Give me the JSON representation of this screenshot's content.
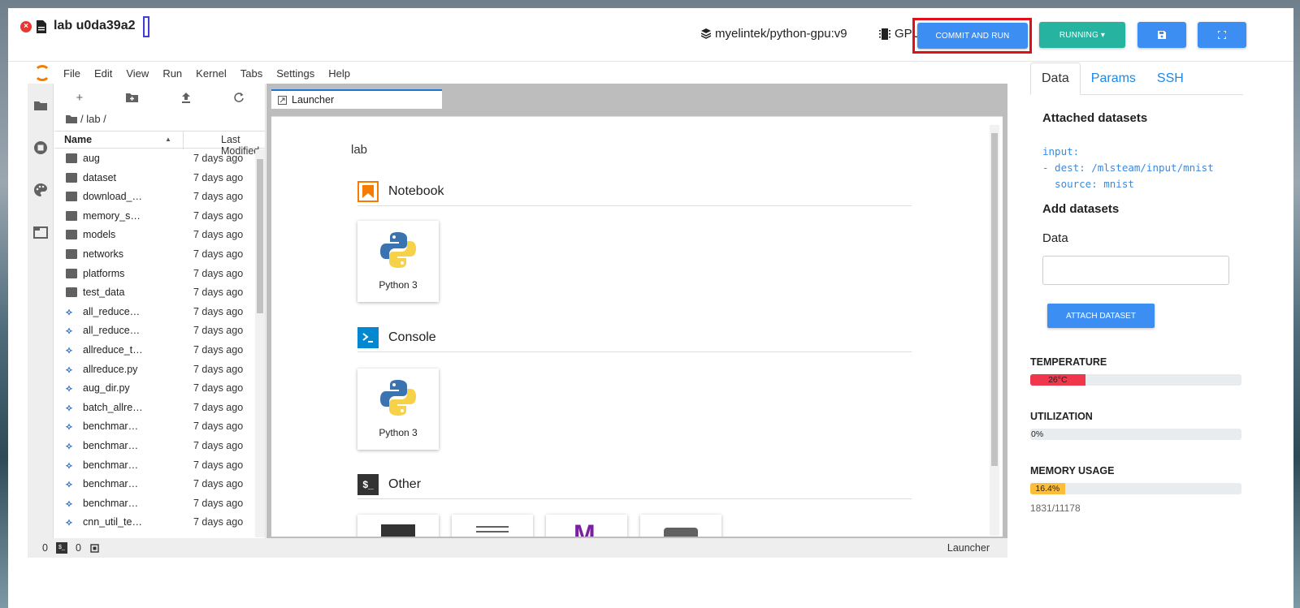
{
  "header": {
    "lab_name": "lab u0da39a2",
    "image": "myelintek/python-gpu:v9",
    "device": "GPU",
    "commit_label": "COMMIT AND RUN",
    "running_label": "RUNNING ▾",
    "save_icon": "save-icon",
    "fullscreen_icon": "fullscreen-icon"
  },
  "menubar": {
    "items": [
      "File",
      "Edit",
      "View",
      "Run",
      "Kernel",
      "Tabs",
      "Settings",
      "Help"
    ]
  },
  "file_browser": {
    "breadcrumb": "/ lab /",
    "col_name": "Name",
    "col_modified": "Last Modified",
    "rows": [
      {
        "name": "aug",
        "type": "folder",
        "modified": "7 days ago"
      },
      {
        "name": "dataset",
        "type": "folder",
        "modified": "7 days ago"
      },
      {
        "name": "download_…",
        "type": "folder",
        "modified": "7 days ago"
      },
      {
        "name": "memory_s…",
        "type": "folder",
        "modified": "7 days ago"
      },
      {
        "name": "models",
        "type": "folder",
        "modified": "7 days ago"
      },
      {
        "name": "networks",
        "type": "folder",
        "modified": "7 days ago"
      },
      {
        "name": "platforms",
        "type": "folder",
        "modified": "7 days ago"
      },
      {
        "name": "test_data",
        "type": "folder",
        "modified": "7 days ago"
      },
      {
        "name": "all_reduce…",
        "type": "python",
        "modified": "7 days ago"
      },
      {
        "name": "all_reduce…",
        "type": "python",
        "modified": "7 days ago"
      },
      {
        "name": "allreduce_t…",
        "type": "python",
        "modified": "7 days ago"
      },
      {
        "name": "allreduce.py",
        "type": "python",
        "modified": "7 days ago"
      },
      {
        "name": "aug_dir.py",
        "type": "python",
        "modified": "7 days ago"
      },
      {
        "name": "batch_allre…",
        "type": "python",
        "modified": "7 days ago"
      },
      {
        "name": "benchmar…",
        "type": "python",
        "modified": "7 days ago"
      },
      {
        "name": "benchmar…",
        "type": "python",
        "modified": "7 days ago"
      },
      {
        "name": "benchmar…",
        "type": "python",
        "modified": "7 days ago"
      },
      {
        "name": "benchmar…",
        "type": "python",
        "modified": "7 days ago"
      },
      {
        "name": "benchmar…",
        "type": "python",
        "modified": "7 days ago"
      },
      {
        "name": "cnn_util_te…",
        "type": "python",
        "modified": "7 days ago"
      }
    ]
  },
  "launcher": {
    "tab_label": "Launcher",
    "title": "lab",
    "sections": {
      "notebook": "Notebook",
      "console": "Console",
      "other": "Other"
    },
    "kernel_label": "Python 3",
    "other_icon": "$_"
  },
  "statusbar": {
    "count1": "0",
    "count2": "0",
    "right": "Launcher"
  },
  "right_panel": {
    "tabs": [
      "Data",
      "Params",
      "SSH"
    ],
    "attached_title": "Attached datasets",
    "yaml": "input:\n- dest: /mlsteam/input/mnist\n  source: mnist",
    "add_title": "Add datasets",
    "data_label": "Data",
    "attach_label": "ATTACH DATASET",
    "metrics": {
      "temperature": {
        "label": "TEMPERATURE",
        "value": "26°C",
        "fraction": 0.26,
        "color": "#f0364a"
      },
      "utilization": {
        "label": "UTILIZATION",
        "value": "0%",
        "fraction": 0.0,
        "color": "#e9ecef"
      },
      "memory": {
        "label": "MEMORY USAGE",
        "value": "16.4%",
        "fraction": 0.164,
        "color": "#fbbd3a",
        "detail": "1831/11178"
      }
    }
  }
}
